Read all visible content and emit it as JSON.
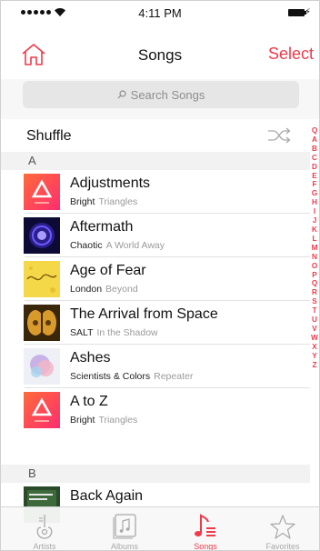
{
  "status_bar": {
    "time": "4:11 PM",
    "charging_symbol": "⚡"
  },
  "nav": {
    "title": "Songs",
    "select_label": "Select",
    "home_icon": "home-icon"
  },
  "search": {
    "placeholder": "Search Songs"
  },
  "shuffle": {
    "label": "Shuffle",
    "icon": "shuffle-icon"
  },
  "sections": [
    {
      "letter": "A"
    },
    {
      "letter": "B"
    }
  ],
  "songs": [
    {
      "title": "Adjustments",
      "artist": "Bright",
      "album": "Triangles",
      "art": "triangle-orange"
    },
    {
      "title": "Aftermath",
      "artist": "Chaotic",
      "album": "A World Away",
      "art": "purple-orb"
    },
    {
      "title": "Age of Fear",
      "artist": "London",
      "album": "Beyond",
      "art": "yellow-script"
    },
    {
      "title": "The Arrival from Space",
      "artist": "SALT",
      "album": "In the Shadow",
      "art": "mirrored-gold"
    },
    {
      "title": "Ashes",
      "artist": "Scientists & Colors",
      "album": "Repeater",
      "art": "pastel-face"
    },
    {
      "title": "A to Z",
      "artist": "Bright",
      "album": "Triangles",
      "art": "triangle-orange"
    },
    {
      "title": "Back Again",
      "artist": "",
      "album": "",
      "art": "living-in-the"
    }
  ],
  "index_letters": [
    "Q",
    "A",
    "B",
    "C",
    "D",
    "E",
    "F",
    "G",
    "H",
    "I",
    "J",
    "K",
    "L",
    "M",
    "N",
    "O",
    "P",
    "Q",
    "R",
    "S",
    "T",
    "U",
    "V",
    "W",
    "X",
    "Y",
    "Z"
  ],
  "tabs": [
    {
      "label": "Artists",
      "icon": "guitar-icon"
    },
    {
      "label": "Albums",
      "icon": "album-icon"
    },
    {
      "label": "Songs",
      "icon": "music-note-icon",
      "active": true
    },
    {
      "label": "Favorites",
      "icon": "star-icon"
    }
  ],
  "colors": {
    "accent": "#ef3a4c",
    "inactive": "#a8a8a8"
  }
}
